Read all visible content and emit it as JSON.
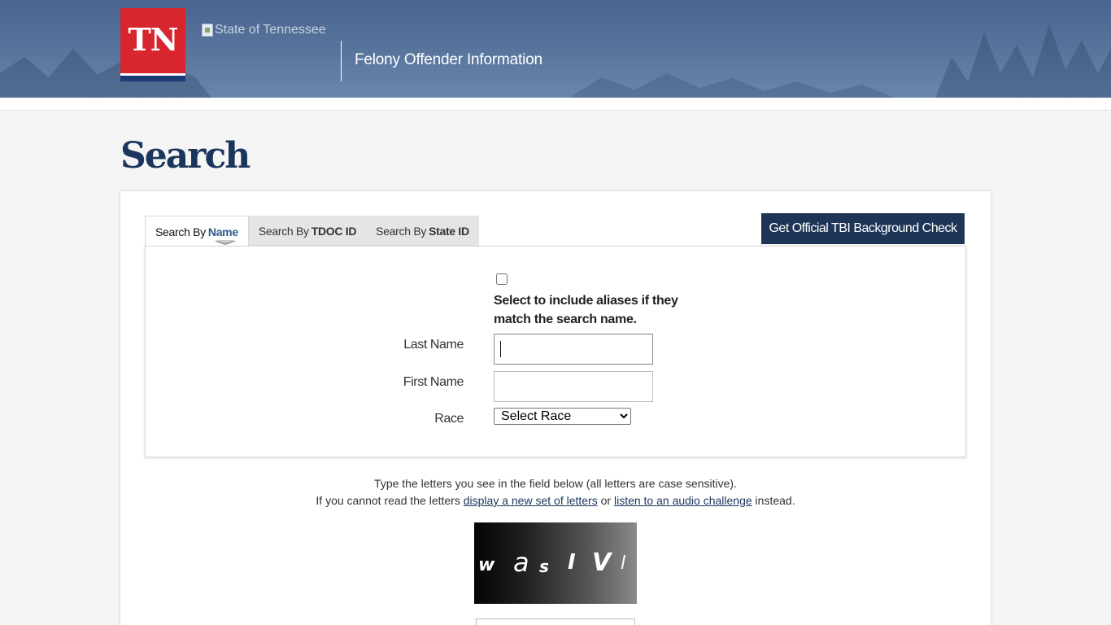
{
  "header": {
    "logo_text": "TN",
    "state_image_alt": "State of Tennessee",
    "site_title": "Felony Offender Information"
  },
  "page": {
    "title": "Search"
  },
  "tabs": [
    {
      "prefix": "Search By",
      "label": "Name",
      "active": true
    },
    {
      "prefix": "Search By",
      "label": "TDOC ID",
      "active": false
    },
    {
      "prefix": "Search By",
      "label": "State ID",
      "active": false
    }
  ],
  "tbi_button": "Get Official TBI Background Check",
  "form": {
    "alias_checked": false,
    "alias_label": "Select to include aliases if they match the search name.",
    "last_name_label": "Last Name",
    "last_name_value": "",
    "first_name_label": "First Name",
    "first_name_value": "",
    "race_label": "Race",
    "race_selected": "Select Race"
  },
  "captcha": {
    "line1": "Type the letters you see in the field below (all letters are case sensitive).",
    "line2_prefix": "If you cannot read the letters",
    "new_letters_link": "display a new set of letters",
    "or_text": "or",
    "audio_link": "listen to an audio challenge",
    "line2_suffix": "instead.",
    "letters": [
      "w",
      "a",
      "s",
      "I",
      "V",
      "l"
    ]
  },
  "colors": {
    "header_bg": "#56729a",
    "logo_red": "#d7262d",
    "title_navy": "#1b365d",
    "button_navy": "#1e3557"
  }
}
